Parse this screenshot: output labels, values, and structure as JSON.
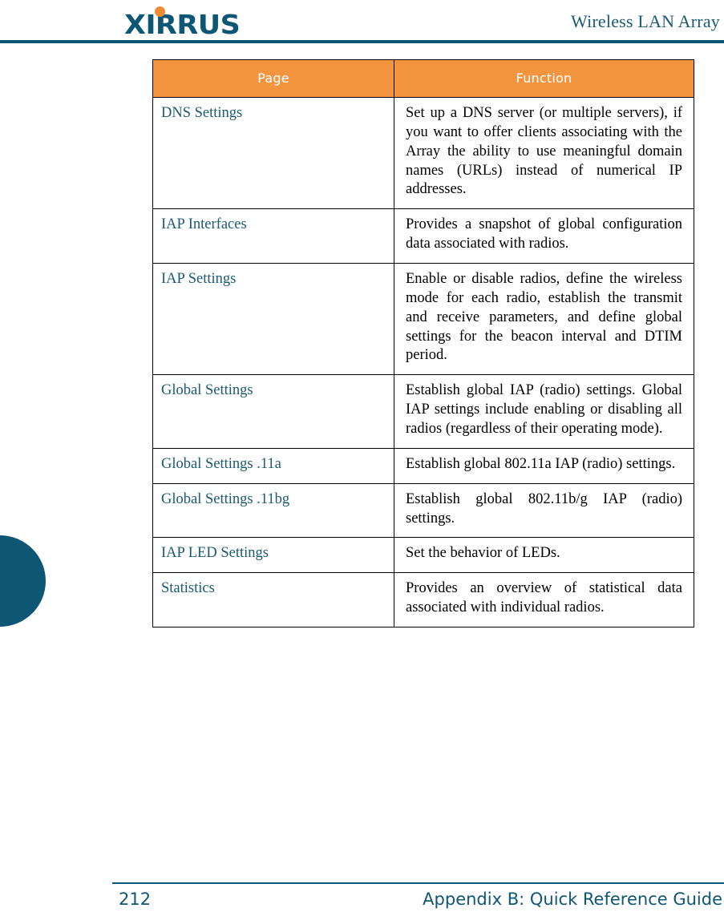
{
  "header": {
    "logo_text": "XIRRUS",
    "logo_dot_color": "#f18a33",
    "logo_color": "#0d5775",
    "title": "Wireless LAN Array",
    "rule_color": "#0d5775"
  },
  "edge_tab": {
    "color": "#0d5775"
  },
  "table": {
    "header_bg": "#f3943f",
    "header_text_color": "#ffffff",
    "page_col_color": "#1a5a73",
    "columns": [
      {
        "label": "Page"
      },
      {
        "label": "Function"
      }
    ],
    "rows": [
      {
        "page": "DNS Settings",
        "function": "Set up a DNS server (or multiple servers), if you want to offer clients associating with the Array the ability to use meaningful domain names (URLs) instead of numerical IP addresses."
      },
      {
        "page": "IAP Interfaces",
        "function": "Provides a snapshot of global configuration data associated with radios."
      },
      {
        "page": "IAP Settings",
        "function": "Enable or disable radios, define the wireless mode for each radio, establish the transmit and receive parameters, and define global settings for the beacon interval and DTIM period."
      },
      {
        "page": "Global Settings",
        "function": "Establish global IAP (radio) settings. Global IAP settings include enabling or disabling all radios (regardless of their operating mode)."
      },
      {
        "page": "Global Settings .11a",
        "function": "Establish global 802.11a IAP (radio) settings."
      },
      {
        "page": "Global Settings .11bg",
        "function": "Establish global 802.11b/g IAP (radio) settings."
      },
      {
        "page": "IAP LED Settings",
        "function": "Set the behavior of LEDs."
      },
      {
        "page": "Statistics",
        "function": "Provides an overview of statistical data associated with individual radios."
      }
    ]
  },
  "footer": {
    "page_number": "212",
    "section_title": "Appendix B: Quick Reference Guide",
    "color": "#0d5775"
  }
}
